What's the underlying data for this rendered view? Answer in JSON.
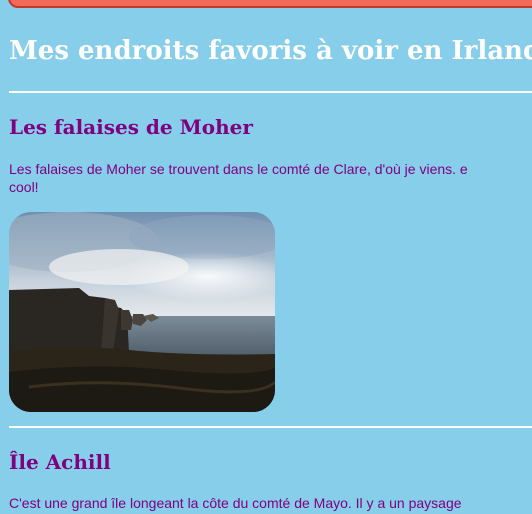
{
  "page": {
    "title": "Mes endroits favoris à voir en Irlande"
  },
  "sections": [
    {
      "heading": "Les falaises de Moher",
      "text_line1": "Les falaises de Moher se trouvent dans le comté de Clare, d'où je viens. e",
      "text_line2": "cool!",
      "image": "cliffs-of-moher-photo"
    },
    {
      "heading": "Île Achill",
      "text_line1": "C'est une grand île longeant la côte du comté de Mayo. Il y a un paysage"
    }
  ],
  "colors": {
    "background": "#87ceeb",
    "title": "#ffffff",
    "heading_text": "#800080",
    "banner": "#f46a5a"
  }
}
